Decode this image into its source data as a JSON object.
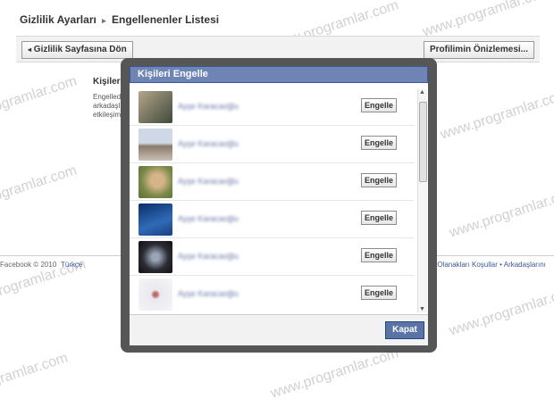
{
  "header": {
    "crumb1": "Gizlilik Ayarları",
    "crumb2": "Engellenenler Listesi",
    "arrow": "▸"
  },
  "topbar": {
    "back_label": "Gizlilik Sayfasına Dön",
    "preview_label": "Profilimin Önizlemesi..."
  },
  "background": {
    "section_title": "Kişileri E",
    "desc_lines": [
      "Engellediğ",
      "arkadaşlık",
      "etkileşimle"
    ]
  },
  "footer": {
    "copyright": "Facebook © 2010",
    "language": "Türkçe",
    "links": "er Olanakları  Koşullar  •  Arkadaşlarını"
  },
  "modal": {
    "title": "Kişileri Engelle",
    "rows": [
      {
        "name": "Ayşe Karacaoğlu",
        "button": "Engelle",
        "color": "#6a7c6a"
      },
      {
        "name": "Ayşe Karacaoğlu",
        "button": "Engelle",
        "color": "#8c9ab0"
      },
      {
        "name": "Ayşe Karacaoğlu",
        "button": "Engelle",
        "color": "#7f8a5c"
      },
      {
        "name": "Ayşe Karacaoğlu",
        "button": "Engelle",
        "color": "#1f4c8a"
      },
      {
        "name": "Ayşe Karacaoğlu",
        "button": "Engelle",
        "color": "#2b2b35"
      },
      {
        "name": "Ayşe Karacaoğlu",
        "button": "Engelle",
        "color": "#e8e8ee"
      }
    ],
    "close_label": "Kapat"
  },
  "watermark": "www.programlar.com"
}
